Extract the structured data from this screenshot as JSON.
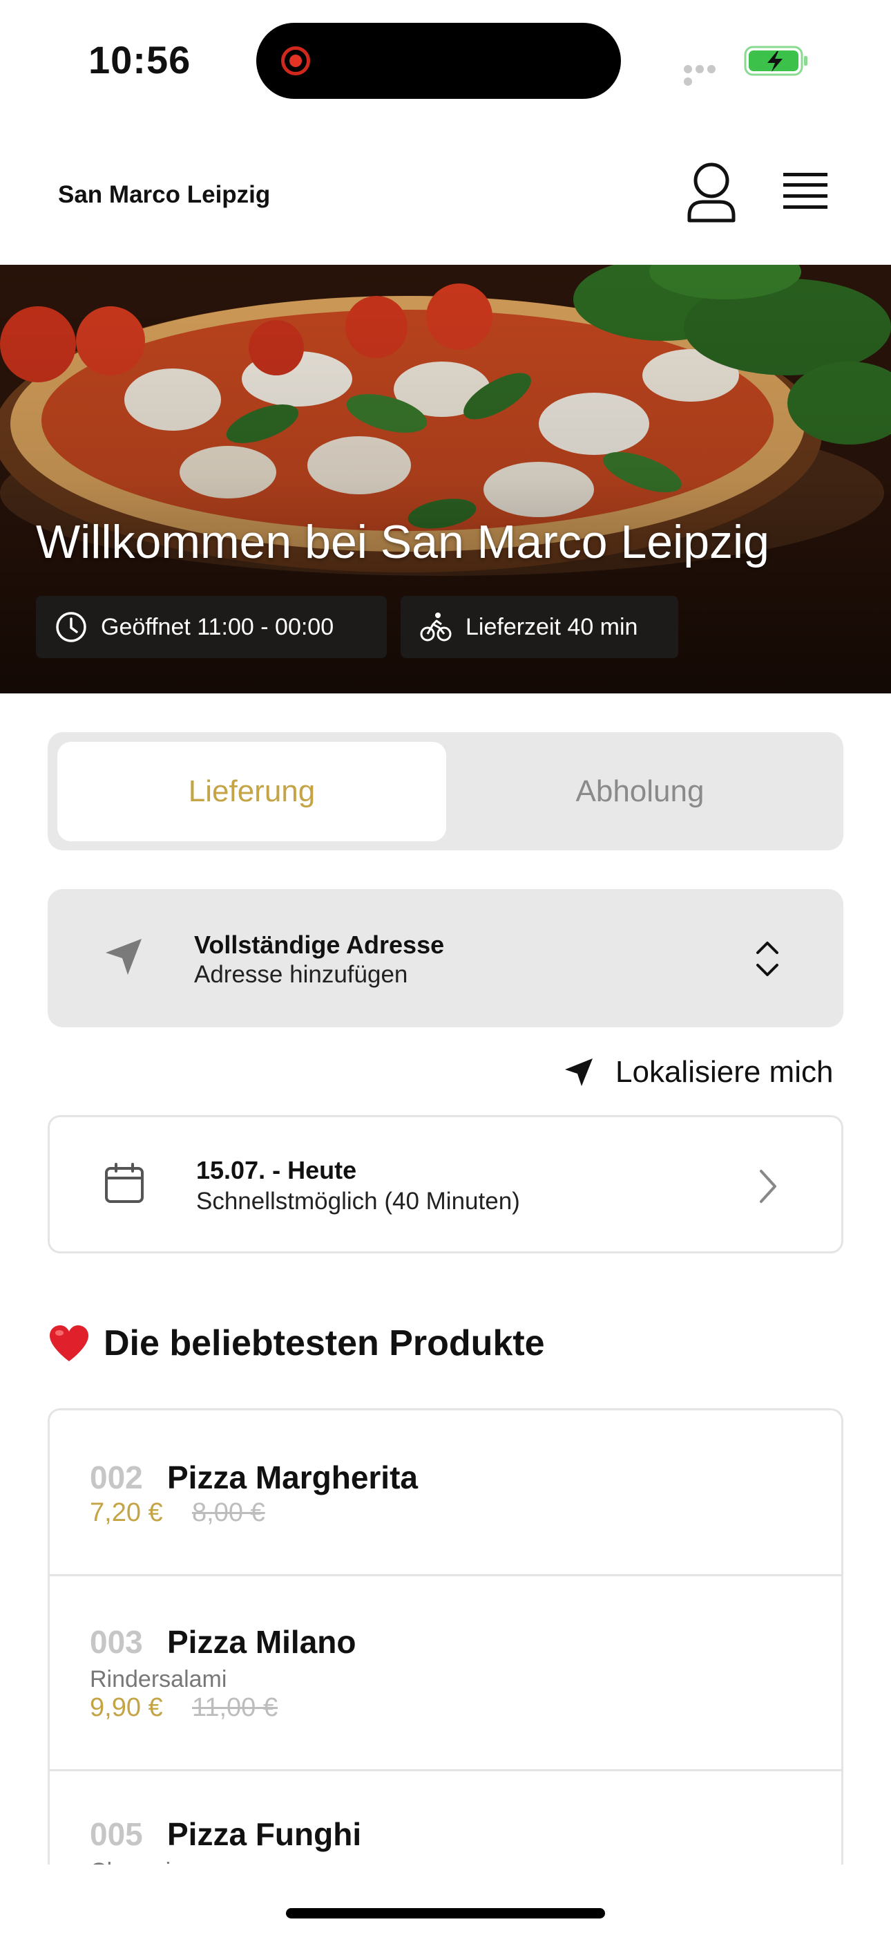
{
  "status_bar": {
    "time": "10:56",
    "battery_color": "#3cc24a"
  },
  "header": {
    "brand": "San Marco Leipzig",
    "icons": [
      "user-icon",
      "hamburger-menu-icon"
    ]
  },
  "hero": {
    "title": "Willkommen bei San Marco Leipzig",
    "hours": "Geöffnet 11:00 - 00:00",
    "delivery_time": "Lieferzeit 40 min",
    "icons": [
      "clock-icon",
      "bicycle-icon"
    ]
  },
  "order_mode": {
    "tabs": [
      "Lieferung",
      "Abholung"
    ],
    "selected": "Lieferung",
    "accent_color": "#c4a445"
  },
  "address": {
    "title": "Vollständige Adresse",
    "subtitle": "Adresse hinzufügen",
    "icon": "location-arrow-icon"
  },
  "locate": {
    "label": "Lokalisiere mich",
    "icon": "location-arrow-icon"
  },
  "schedule": {
    "title": "15.07. - Heute",
    "subtitle": "Schnellstmöglich (40 Minuten)",
    "icon": "calendar-icon"
  },
  "popular": {
    "title": "Die beliebtesten Produkte",
    "icon": "heart-icon",
    "products": [
      {
        "number": "002",
        "name": "Pizza Margherita",
        "description": "",
        "price": "7,20 €",
        "old_price": "8,00 €"
      },
      {
        "number": "003",
        "name": "Pizza Milano",
        "description": "Rindersalami",
        "price": "9,90 €",
        "old_price": "11,00 €"
      },
      {
        "number": "005",
        "name": "Pizza Funghi",
        "description": "Champignons",
        "price": "",
        "old_price": ""
      }
    ]
  }
}
